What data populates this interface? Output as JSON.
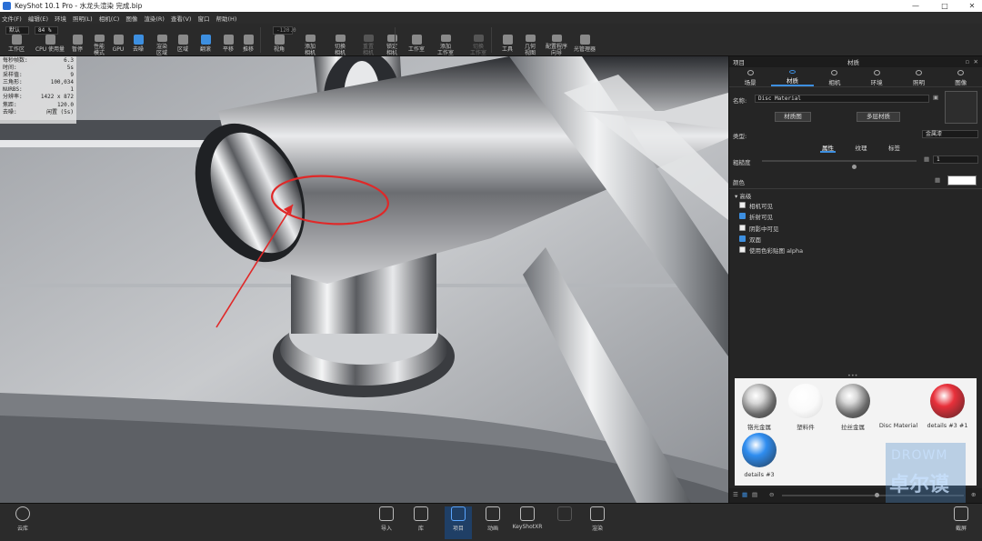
{
  "window": {
    "title": "KeyShot 10.1 Pro  -  水龙头渲染 完成.bip",
    "min": "—",
    "max": "□",
    "close": "✕"
  },
  "menu": [
    "文件(F)",
    "编辑(E)",
    "环境",
    "照明(L)",
    "相机(C)",
    "图像",
    "渲染(R)",
    "查看(V)",
    "窗口",
    "帮助(H)"
  ],
  "toolbar": {
    "preset": "默认",
    "zoom": "84 %",
    "items": [
      {
        "label": "工作区",
        "state": "normal"
      },
      {
        "label": "CPU 使用量",
        "state": "normal"
      },
      {
        "label": "暂停",
        "state": "normal"
      },
      {
        "label": "性能\n模式",
        "state": "normal"
      },
      {
        "label": "GPU",
        "state": "normal"
      },
      {
        "label": "去噪",
        "state": "active"
      },
      {
        "label": "渲染\n区域",
        "state": "normal"
      },
      {
        "label": "区域",
        "state": "normal"
      },
      {
        "label": "翻滚",
        "state": "active"
      },
      {
        "label": "平移",
        "state": "normal"
      },
      {
        "label": "推移",
        "state": "normal"
      },
      {
        "label": "视角",
        "state": "normal"
      },
      {
        "label": "添加\n相机",
        "state": "normal"
      },
      {
        "label": "切换\n相机",
        "state": "normal"
      },
      {
        "label": "重置\n相机",
        "state": "dim"
      },
      {
        "label": "锁定\n相机",
        "state": "normal"
      },
      {
        "label": "工作室",
        "state": "normal"
      },
      {
        "label": "添加\n工作室",
        "state": "normal"
      },
      {
        "label": "切换\n工作室",
        "state": "dim"
      },
      {
        "label": "工具",
        "state": "normal"
      },
      {
        "label": "几何\n视图",
        "state": "normal"
      },
      {
        "label": "配置程序\n向导",
        "state": "normal"
      },
      {
        "label": "光管理器",
        "state": "normal"
      }
    ],
    "fov": "-120.0"
  },
  "hud": [
    {
      "k": "每秒帧数:",
      "v": "6.3"
    },
    {
      "k": "时间:",
      "v": "5s"
    },
    {
      "k": "采样值:",
      "v": "9"
    },
    {
      "k": "三角形:",
      "v": "100,034"
    },
    {
      "k": "NURBS:",
      "v": "1"
    },
    {
      "k": "分辨率:",
      "v": "1422 x 872"
    },
    {
      "k": "焦距:",
      "v": "120.0"
    },
    {
      "k": "去噪:",
      "v": "闲置 (5s)"
    }
  ],
  "panel": {
    "left_header": "项目",
    "title": "材质",
    "tabs": [
      "场景",
      "材质",
      "相机",
      "环境",
      "照明",
      "图像"
    ],
    "active_tab": 1,
    "name_label": "名称:",
    "name_value": "Disc Material",
    "btn_graph": "材质图",
    "btn_multi": "多层材质",
    "type_label": "类型:",
    "type_value": "金属漆",
    "subtabs": [
      "属性",
      "纹理",
      "标签"
    ],
    "roughness_label": "粗糙度",
    "roughness_value": "1",
    "color_label": "颜色",
    "advanced": "高级",
    "checks": [
      {
        "label": "相机可见",
        "checked": false
      },
      {
        "label": "折射可见",
        "checked": true
      },
      {
        "label": "阴影中可见",
        "checked": false
      },
      {
        "label": "双面",
        "checked": true
      },
      {
        "label": "使用色彩贴图 alpha",
        "checked": false
      }
    ],
    "handle": "•••",
    "materials": [
      {
        "name": "铬光金属",
        "color": "chrome"
      },
      {
        "name": "塑料件",
        "color": "white"
      },
      {
        "name": "拉丝金属",
        "color": "chrome"
      },
      {
        "name": "Disc Material",
        "color": "none"
      },
      {
        "name": "details #3 #1",
        "color": "#e8303a"
      },
      {
        "name": "details #3",
        "color": "#2f8df0"
      }
    ]
  },
  "watermark": {
    "top": "DROWM",
    "bottom": "卓尔谟"
  },
  "bottom": {
    "library": "云库",
    "buttons": [
      {
        "label": "导入",
        "state": "normal"
      },
      {
        "label": "库",
        "state": "normal"
      },
      {
        "label": "项目",
        "state": "active"
      },
      {
        "label": "动画",
        "state": "normal"
      },
      {
        "label": "KeyShotXR",
        "state": "normal"
      },
      {
        "label": "",
        "state": "dim"
      },
      {
        "label": "渲染",
        "state": "normal"
      }
    ],
    "screenshot": "截屏"
  }
}
